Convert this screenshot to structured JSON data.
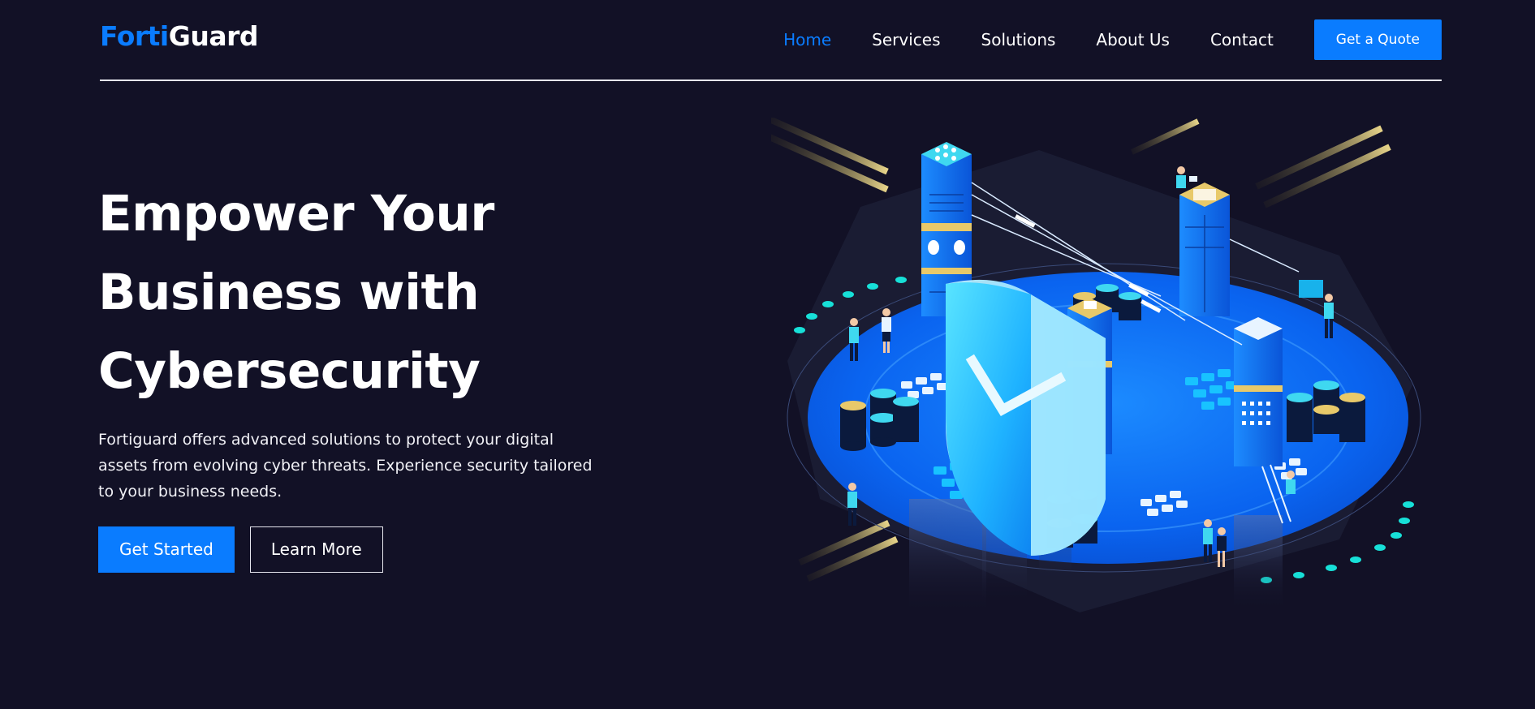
{
  "brand": {
    "logo_part1": "Forti",
    "logo_part2": "Guard"
  },
  "nav": {
    "items": [
      {
        "label": "Home",
        "active": true
      },
      {
        "label": "Services",
        "active": false
      },
      {
        "label": "Solutions",
        "active": false
      },
      {
        "label": "About Us",
        "active": false
      },
      {
        "label": "Contact",
        "active": false
      }
    ],
    "quote_label": "Get a Quote"
  },
  "hero": {
    "title_lines": [
      "Empower Your",
      "Business with",
      "Cybersecurity"
    ],
    "description": "Fortiguard offers advanced solutions to protect your digital assets from evolving cyber threats. Experience security tailored to your business needs.",
    "primary_button": "Get Started",
    "secondary_button": "Learn More"
  },
  "illustration": {
    "icon": "isometric-security-shield-illustration"
  },
  "colors": {
    "background": "#121126",
    "accent": "#0a7cff",
    "text": "#ffffff"
  }
}
